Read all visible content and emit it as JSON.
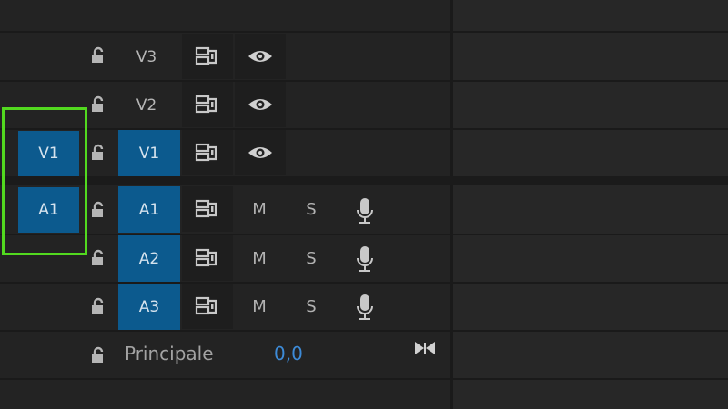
{
  "tracks": {
    "video": [
      {
        "label": "V3",
        "source": "",
        "active": false
      },
      {
        "label": "V2",
        "source": "",
        "active": false
      },
      {
        "label": "V1",
        "source": "V1",
        "active": true
      }
    ],
    "audio": [
      {
        "label": "A1",
        "source": "A1",
        "active": true,
        "mute_label": "M",
        "solo_label": "S"
      },
      {
        "label": "A2",
        "source": "",
        "active": true,
        "mute_label": "M",
        "solo_label": "S"
      },
      {
        "label": "A3",
        "source": "",
        "active": true,
        "mute_label": "M",
        "solo_label": "S"
      }
    ]
  },
  "master": {
    "label": "Principale",
    "value": "0,0"
  },
  "colors": {
    "background": "#232323",
    "active_track": "#0c5a8e",
    "highlight": "#52d91f",
    "value_blue": "#3d8bd8"
  },
  "icons": {
    "lock": "unlocked-padlock-icon",
    "sync": "sync-lock-icon",
    "eye": "eye-icon",
    "mic": "microphone-icon",
    "master_toggle": "bowtie-collapse-icon"
  }
}
